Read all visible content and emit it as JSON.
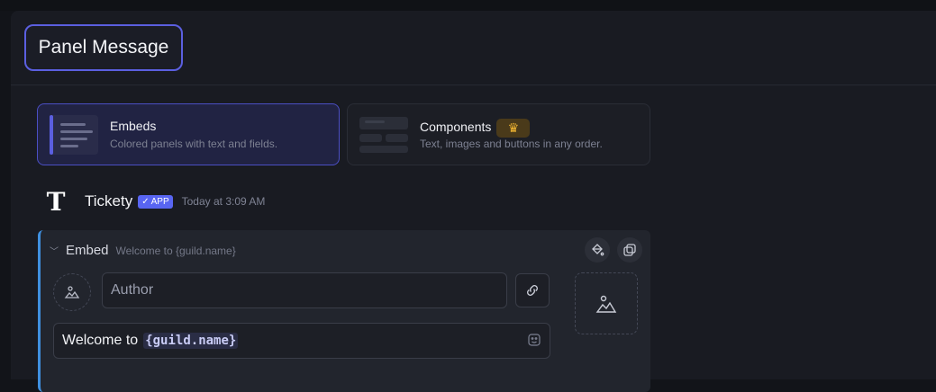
{
  "panel": {
    "title": "Panel Message"
  },
  "modes": [
    {
      "title": "Embeds",
      "description": "Colored panels with text and fields.",
      "selected": true
    },
    {
      "title": "Components",
      "description": "Text, images and buttons in any order.",
      "selected": false,
      "premium_icon": "crown-icon"
    }
  ],
  "message": {
    "bot_name": "Tickety",
    "app_badge": "APP",
    "timestamp": "Today at 3:09 AM",
    "avatar_letter": "T"
  },
  "embed": {
    "label": "Embed",
    "subtitle": "Welcome to {guild.name}",
    "author_placeholder": "Author",
    "title_prefix": "Welcome to",
    "title_variable": "{guild.name}",
    "accent_color": "#3f90e0"
  },
  "colors": {
    "accent": "#5b5fe0",
    "premium": "#f2b632"
  }
}
